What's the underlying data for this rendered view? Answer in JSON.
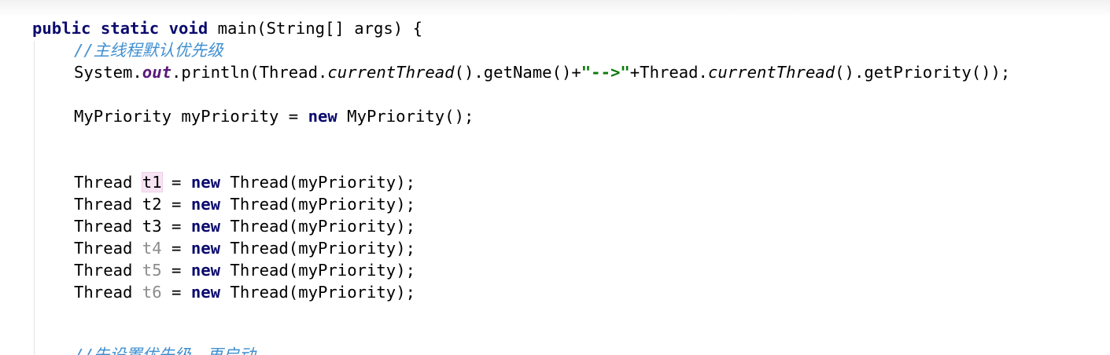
{
  "editor": {
    "lines": {
      "main_signature": {
        "kw_public": "public",
        "kw_static": "static",
        "kw_void": "void",
        "rest": " main(String[] args) {"
      },
      "comment_main_priority": "//主线程默认优先级",
      "println": {
        "system": "System.",
        "out": "out",
        "println_open": ".println(Thread.",
        "current_thread_1": "currentThread",
        "get_name": "().getName()+",
        "string_literal": "\"-->\"",
        "plus_thread": "+Thread.",
        "current_thread_2": "currentThread",
        "get_priority": "().getPriority());"
      },
      "my_priority_decl": {
        "left": "MyPriority myPriority = ",
        "kw_new": "new",
        "right": " MyPriority();"
      },
      "thread_decls": [
        {
          "type": "Thread ",
          "var": "t1",
          "assign": " = ",
          "kw_new": "new",
          "ctor": " Thread(myPriority);"
        },
        {
          "type": "Thread ",
          "var": "t2",
          "assign": " = ",
          "kw_new": "new",
          "ctor": " Thread(myPriority);"
        },
        {
          "type": "Thread ",
          "var": "t3",
          "assign": " = ",
          "kw_new": "new",
          "ctor": " Thread(myPriority);"
        },
        {
          "type": "Thread ",
          "var": "t4",
          "assign": " = ",
          "kw_new": "new",
          "ctor": " Thread(myPriority);"
        },
        {
          "type": "Thread ",
          "var": "t5",
          "assign": " = ",
          "kw_new": "new",
          "ctor": " Thread(myPriority);"
        },
        {
          "type": "Thread ",
          "var": "t6",
          "assign": " = ",
          "kw_new": "new",
          "ctor": " Thread(myPriority);"
        }
      ],
      "comment_set_priority_partial": "//先设置优先级，再启动"
    }
  },
  "colors": {
    "keyword": "#0a0a6e",
    "static_field": "#5b1a7a",
    "string": "#0b7a0b",
    "comment": "#3f8fd0",
    "unused_variable": "#8c8c8c",
    "highlight": "#f6e4f2"
  }
}
